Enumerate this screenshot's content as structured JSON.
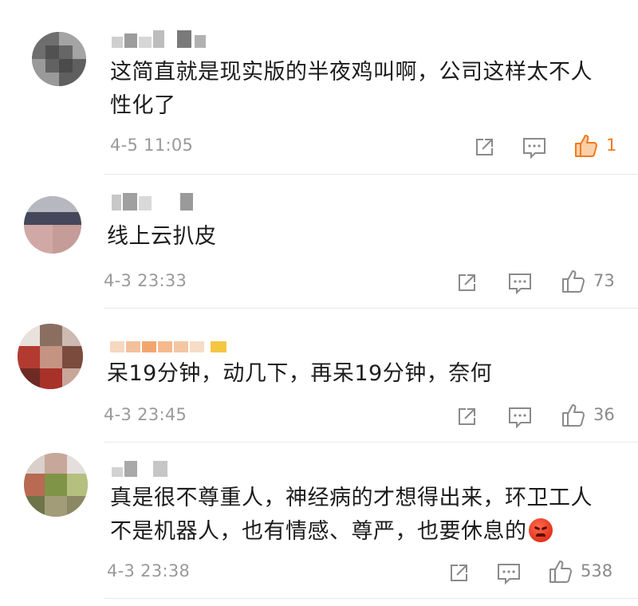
{
  "comments": [
    {
      "text": "这简直就是现实版的半夜鸡叫啊，公司这样太不人\n性化了",
      "time": "4-5 11:05",
      "likes": "1",
      "liked": true
    },
    {
      "text": "线上云扒皮",
      "time": "4-3 23:33",
      "likes": "73",
      "liked": false
    },
    {
      "text": "呆19分钟，动几下，再呆19分钟，奈何",
      "time": "4-3 23:45",
      "likes": "36",
      "liked": false
    },
    {
      "text": "真是很不尊重人，神经病的才想得出来，环卫工人\n不是机器人，也有情感、尊严，也要休息的",
      "time": "4-3 23:38",
      "likes": "538",
      "liked": false,
      "emoji": "angry-face-emoji"
    }
  ],
  "icons": {
    "share": "share-icon",
    "comment": "comment-icon",
    "like": "thumbs-up-icon"
  },
  "colors": {
    "liked": "#f07a1d",
    "icon": "#8a8a8a",
    "time": "#9a9a9a",
    "divider": "#e8e8e8"
  }
}
